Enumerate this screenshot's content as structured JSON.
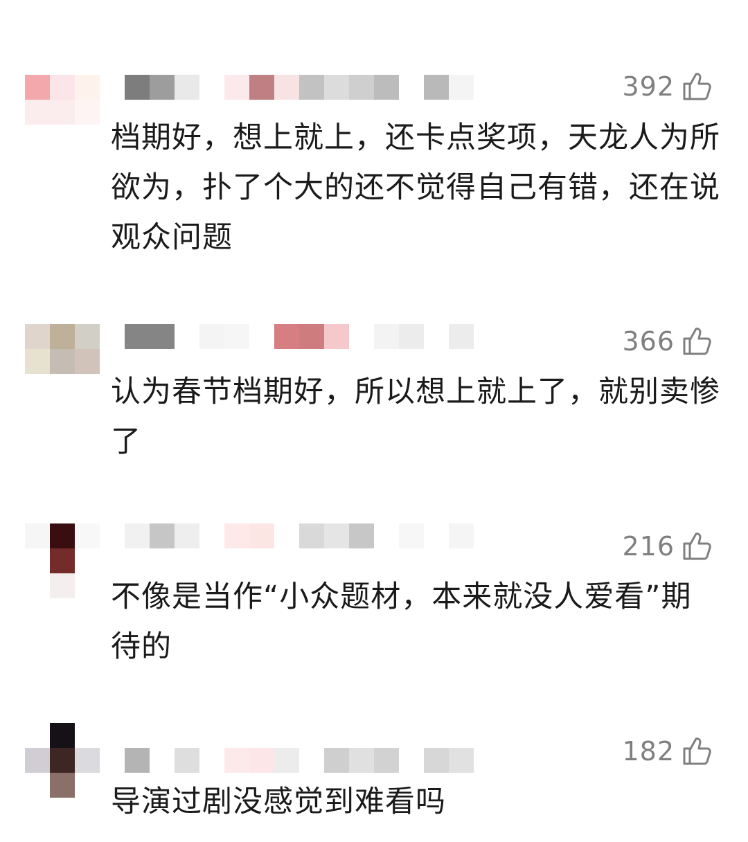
{
  "comments": [
    {
      "likes": "392",
      "text": "档期好，想上就上，还卡点奖项，天龙人为所欲为，扑了个大的还不觉得自己有错，还在说观众问题",
      "avatar_colors": [
        "#f3a8ab",
        "#fbe5e8",
        "#fdf2ec",
        "#fbeced",
        "#fbeced",
        "#fdf4f3",
        "#ffffff",
        "#ffffff",
        "#ffffff"
      ],
      "name_blocks": [
        "#7d7d7d",
        "#9d9d9d",
        "#e9e9e9",
        "#ffffff",
        "#fbe9ec",
        "#c07f82",
        "#f8e3e4",
        "#c2c2c2",
        "#dcdcdc",
        "#cfcfcf",
        "#bcbcbc",
        "#ffffff",
        "#b9b9b9",
        "#f4f4f4"
      ]
    },
    {
      "likes": "366",
      "text": "认为春节档期好，所以想上就上了，就别卖惨了",
      "avatar_colors": [
        "#e0d5cc",
        "#bfb09a",
        "#d2cfc6",
        "#e7e2cf",
        "#c5bdb3",
        "#d1c3b9",
        "#ffffff",
        "#ffffff",
        "#ffffff"
      ],
      "name_blocks": [
        "#858585",
        "#858585",
        "#ffffff",
        "#f4f4f4",
        "#f6f6f6",
        "#ffffff",
        "#d77e83",
        "#cf7c7e",
        "#f5c8cb",
        "#ffffff",
        "#f3f3f3",
        "#ececec",
        "#ffffff",
        "#ececec"
      ]
    },
    {
      "likes": "216",
      "text": "不像是当作“小众题材，本来就没人爱看”期待的",
      "avatar_colors": [
        "#f6f6f6",
        "#3a0e10",
        "#f8f8f8",
        "#ffffff",
        "#742c2a",
        "#ffffff",
        "#ffffff",
        "#f4eeee",
        "#ffffff"
      ],
      "name_blocks": [
        "#f1f1f1",
        "#c6c6c6",
        "#eeeeee",
        "#ffffff",
        "#fde9e7",
        "#fce6e3",
        "#ffffff",
        "#d9d9d9",
        "#e5e5e5",
        "#c7c7c7",
        "#ffffff",
        "#f7f7f7",
        "#ffffff",
        "#f5f5f5"
      ]
    },
    {
      "likes": "182",
      "text": "导演过剧没感觉到难看吗",
      "avatar_colors": [
        "#ffffff",
        "#161116",
        "#ffffff",
        "#d0cdd4",
        "#3d2624",
        "#dadadf",
        "#ffffff",
        "#8a7069",
        "#ffffff"
      ],
      "name_blocks": [
        "#b4b4b4",
        "#ffffff",
        "#dedede",
        "#ffffff",
        "#fce9ea",
        "#fde6e7",
        "#ececec",
        "#ffffff",
        "#cfcfcf",
        "#e0e0e0",
        "#d2d2d2",
        "#ffffff",
        "#d7d7d7",
        "#e1e1e1"
      ]
    }
  ],
  "like_icon": "thumbs-up-icon",
  "colors": {
    "text": "#1a1a1a",
    "like_count": "#7f7f7f",
    "icon_stroke": "#7f7f7f"
  }
}
